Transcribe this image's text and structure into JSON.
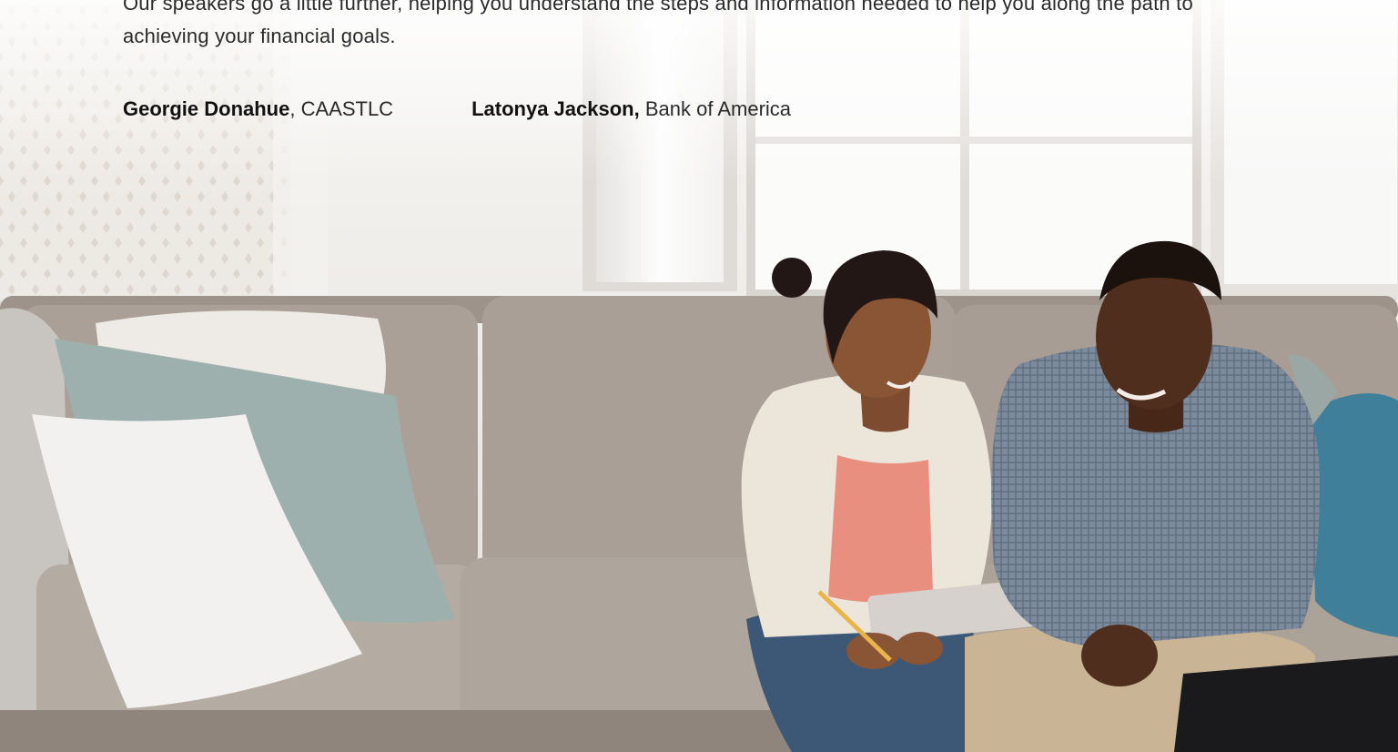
{
  "intro": {
    "text": "Our speakers go a little further, helping you understand the steps and information needed to help you along the path to achieving your financial goals."
  },
  "speakers": [
    {
      "name": "Georgie Donahue",
      "separator": ", ",
      "org": "CAASTLC"
    },
    {
      "name": "Latonya Jackson,",
      "separator": " ",
      "org": "Bank of America"
    }
  ],
  "colors": {
    "wall": "#f1efec",
    "window_light": "#fbfbfa",
    "sofa": "#a79c93",
    "sofa_shadow": "#8d8279",
    "pillow_white": "#efeeec",
    "pillow_teal": "#9fb1ae",
    "throw_blue": "#3f7f9a",
    "cardigan": "#ece6da",
    "top_pink": "#e98f80",
    "jeans": "#3d5877",
    "shirt": "#6f7f92",
    "khakis": "#c9b595",
    "skin_woman": "#8a5535",
    "skin_man": "#4f2e1d"
  }
}
